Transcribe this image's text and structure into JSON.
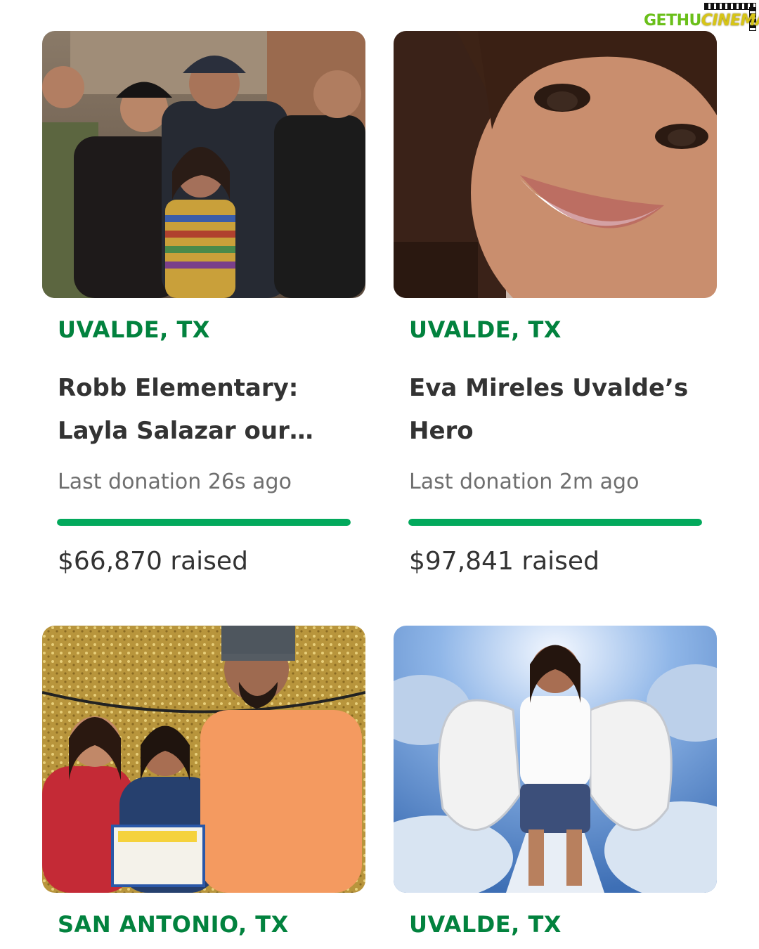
{
  "watermark": {
    "part1": "GETHU",
    "part2": "CINEMA"
  },
  "colors": {
    "location_green": "#02823e",
    "progress_green": "#02a95c",
    "title_text": "#333333",
    "meta_text": "#6f6f6f"
  },
  "fundraisers": [
    {
      "location": "UVALDE, TX",
      "title": "Robb Elementary: Layla Salazar our beloved angel",
      "last_donation": "Last donation 26s ago",
      "progress": 1.0,
      "raised": "$66,870 raised",
      "image": "family-photo"
    },
    {
      "location": "UVALDE, TX",
      "title": "Eva Mireles Uvalde’s Hero",
      "last_donation": "Last donation 2m ago",
      "progress": 1.0,
      "raised": "$97,841 raised",
      "image": "portrait-photo"
    },
    {
      "location": "SAN ANTONIO, TX",
      "image": "honor-roll-family-photo"
    },
    {
      "location": "UVALDE, TX",
      "image": "angel-memorial-photo"
    }
  ]
}
